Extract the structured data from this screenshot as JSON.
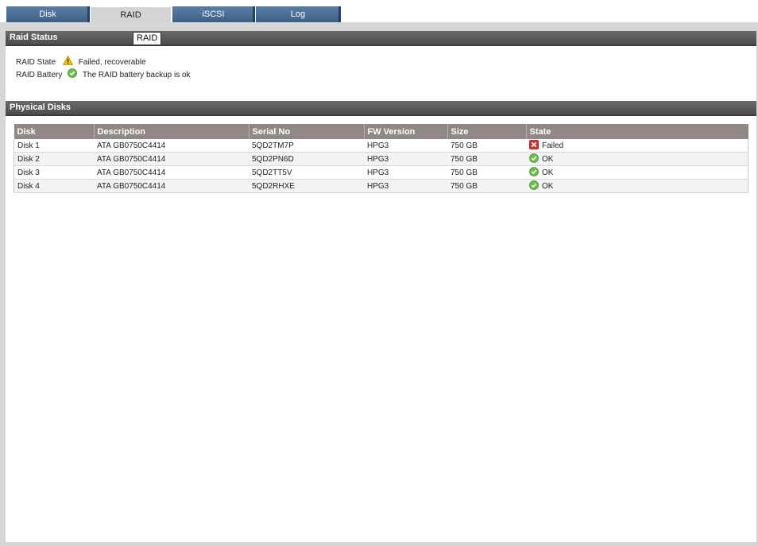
{
  "tabs": [
    {
      "label": "Disk"
    },
    {
      "label": "RAID"
    },
    {
      "label": "iSCSI"
    },
    {
      "label": "Log"
    }
  ],
  "active_tab": "RAID",
  "raid_status": {
    "header": "Raid Status",
    "badge": "RAID",
    "state_label": "RAID State",
    "state_icon": "warning-icon",
    "state_value": "Failed, recoverable",
    "battery_label": "RAID Battery",
    "battery_icon": "ok-check-icon",
    "battery_value": "The RAID battery backup is ok"
  },
  "physical_disks": {
    "header": "Physical Disks",
    "columns": [
      "Disk",
      "Description",
      "Serial No",
      "FW Version",
      "Size",
      "State"
    ],
    "rows": [
      {
        "disk": "Disk 1",
        "description": "ATA GB0750C4414",
        "serial": "5QD2TM7P",
        "fw": "HPG3",
        "size": "750 GB",
        "state": "Failed",
        "state_icon": "failed-x-icon"
      },
      {
        "disk": "Disk 2",
        "description": "ATA GB0750C4414",
        "serial": "5QD2PN6D",
        "fw": "HPG3",
        "size": "750 GB",
        "state": "OK",
        "state_icon": "ok-check-icon"
      },
      {
        "disk": "Disk 3",
        "description": "ATA GB0750C4414",
        "serial": "5QD2TT5V",
        "fw": "HPG3",
        "size": "750 GB",
        "state": "OK",
        "state_icon": "ok-check-icon"
      },
      {
        "disk": "Disk 4",
        "description": "ATA GB0750C4414",
        "serial": "5QD2RHXE",
        "fw": "HPG3",
        "size": "750 GB",
        "state": "OK",
        "state_icon": "ok-check-icon"
      }
    ]
  },
  "colors": {
    "tab_blue": "#3d6089",
    "header_gray": "#555555",
    "table_header": "#8f8885",
    "ok_green": "#4caf50",
    "fail_red": "#d0312d",
    "warn_yellow": "#f2c200"
  }
}
